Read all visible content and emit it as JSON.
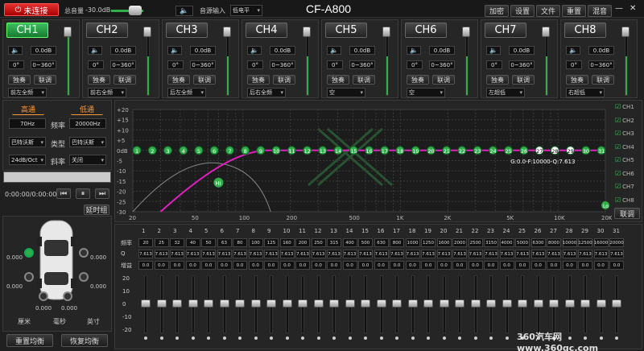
{
  "titlebar": {
    "connect_label": "未连接",
    "master_volume_label": "总音量",
    "master_volume_value": "-30.0dB",
    "source_label": "音源输入",
    "source_value": "低电平",
    "app_title": "CF-A800",
    "buttons": [
      "加密",
      "设置",
      "文件",
      "重置",
      "混音"
    ],
    "minimize": "—",
    "close": "✕"
  },
  "channels": [
    {
      "name": "CH1",
      "gain": "0.0dB",
      "delay": "0°",
      "phase": "0~360°",
      "solo": "独奏",
      "link": "联调",
      "position": "前左全频",
      "active": true
    },
    {
      "name": "CH2",
      "gain": "0.0dB",
      "delay": "0°",
      "phase": "0~360°",
      "solo": "独奏",
      "link": "联调",
      "position": "前右全频",
      "active": false
    },
    {
      "name": "CH3",
      "gain": "0.0dB",
      "delay": "0°",
      "phase": "0~360°",
      "solo": "独奏",
      "link": "联调",
      "position": "后左全频",
      "active": false
    },
    {
      "name": "CH4",
      "gain": "0.0dB",
      "delay": "0°",
      "phase": "0~360°",
      "solo": "独奏",
      "link": "联调",
      "position": "后右全频",
      "active": false
    },
    {
      "name": "CH5",
      "gain": "0.0dB",
      "delay": "0°",
      "phase": "0~360°",
      "solo": "独奏",
      "link": "联调",
      "position": "空",
      "active": false
    },
    {
      "name": "CH6",
      "gain": "0.0dB",
      "delay": "0°",
      "phase": "0~360°",
      "solo": "独奏",
      "link": "联调",
      "position": "空",
      "active": false
    },
    {
      "name": "CH7",
      "gain": "0.0dB",
      "delay": "0°",
      "phase": "0~360°",
      "solo": "独奏",
      "link": "联调",
      "position": "左超低",
      "active": false
    },
    {
      "name": "CH8",
      "gain": "0.0dB",
      "delay": "0°",
      "phase": "0~360°",
      "solo": "独奏",
      "link": "联调",
      "position": "右超低",
      "active": false
    }
  ],
  "crossover": {
    "high_label": "高通",
    "low_label": "低通",
    "high_freq": "70Hz",
    "freq_label": "频率",
    "low_freq": "20000Hz",
    "high_type": "巴特沃斯",
    "type_label": "类型",
    "low_type": "巴特沃斯",
    "high_slope": "24dB/Oct",
    "slope_label": "斜率",
    "low_slope": "关闭"
  },
  "player": {
    "time": "0:00:00/0:00:00",
    "delay_group": "延时组"
  },
  "car": {
    "values": [
      "0.000",
      "0.000",
      "0.000",
      "0.000",
      "0.000",
      "0.000",
      "0.000",
      "0.000"
    ],
    "units": [
      "厘米",
      "毫秒",
      "英寸"
    ],
    "reset_eq": "重置均衡",
    "restore_eq": "恢复均衡"
  },
  "graph": {
    "y_ticks": [
      "+20",
      "+15",
      "+10",
      "+5",
      "0dB",
      "-5",
      "-10",
      "-15",
      "-20",
      "-25",
      "-30"
    ],
    "x_ticks": [
      "20",
      "50",
      "100",
      "200",
      "500",
      "1K",
      "2K",
      "5K",
      "10K",
      "20K"
    ],
    "point_info": "G:0.0-F:10000-Q:7.613",
    "hi_marker": "Hi",
    "lo_marker": "Lo",
    "link_button": "联调",
    "channel_checks": [
      "CH1",
      "CH2",
      "CH3",
      "CH4",
      "CH5",
      "CH6",
      "CH7",
      "CH8"
    ],
    "band_points": [
      "1",
      "2",
      "3",
      "4",
      "5",
      "6",
      "7",
      "8",
      "9",
      "10",
      "11",
      "12",
      "13",
      "14",
      "15",
      "16",
      "17",
      "18",
      "19",
      "20",
      "21",
      "22",
      "23",
      "24",
      "25",
      "26",
      "27",
      "28",
      "29",
      "30",
      "31"
    ]
  },
  "eq_table": {
    "row_labels": [
      "频率",
      "Q",
      "增益"
    ],
    "bands": [
      "1",
      "2",
      "3",
      "4",
      "5",
      "6",
      "7",
      "8",
      "9",
      "10",
      "11",
      "12",
      "13",
      "14",
      "15",
      "16",
      "17",
      "18",
      "19",
      "20",
      "21",
      "22",
      "23",
      "24",
      "25",
      "26",
      "27",
      "28",
      "29",
      "30",
      "31"
    ],
    "freqs": [
      "20",
      "25",
      "32",
      "40",
      "50",
      "63",
      "80",
      "100",
      "125",
      "160",
      "200",
      "250",
      "315",
      "400",
      "500",
      "630",
      "800",
      "1000",
      "1250",
      "1600",
      "2000",
      "2500",
      "3150",
      "4000",
      "5000",
      "6300",
      "8000",
      "10000",
      "12500",
      "16000",
      "20000"
    ],
    "q": "7.613",
    "gain": "0.0",
    "slider_scale": [
      "20",
      "10",
      "0",
      "-10",
      "-20"
    ]
  },
  "watermark": "360汽车网 www.360qc.com",
  "colors": {
    "accent": "#2fae4a",
    "curve": "#e020c0",
    "danger": "#d82020"
  }
}
